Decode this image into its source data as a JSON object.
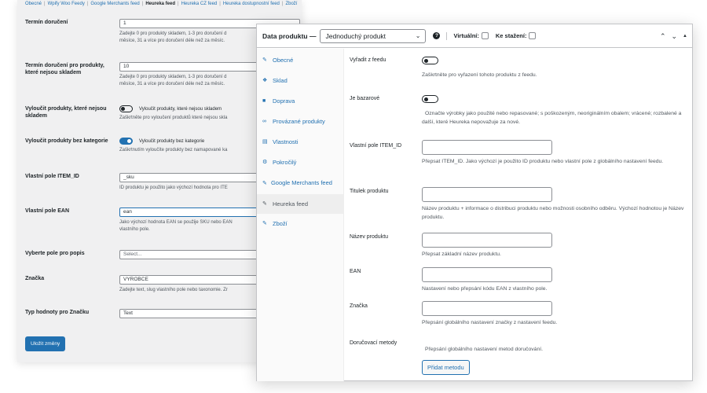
{
  "settings": {
    "subnav": [
      "Obecné",
      "Wpify Woo Feedy",
      "Google Merchants feed",
      "Heureka feed",
      "Heureka CZ feed",
      "Heureka dostupnostní feed",
      "Zboží"
    ],
    "subnav_current_index": 3,
    "delivery_label": "Termín doručení",
    "delivery_value": "1",
    "delivery_desc_1": "Zadejte 0 pro produkty skladem, 1-3 pro doručení d",
    "delivery_desc_2": "měsíce, 31 a více pro doručení déle než za měsíc.",
    "delivery_oos_label": "Termín doručení pro produkty, které nejsou skladem",
    "delivery_oos_value": "10",
    "delivery_oos_desc_1": "Zadejte 0 pro produkty skladem, 1-3 pro doručení d",
    "delivery_oos_desc_2": "měsíce, 31 a více pro doručení déle než za měsíc.",
    "exclude_oos_label": "Vyloučit produkty, které nejsou skladem",
    "exclude_oos_toggle": "Vyloučit produkty, které nejsou skladem",
    "exclude_oos_desc": "Zaškrtněte pro vyloučení produktů které nejsou skla",
    "exclude_nocat_label": "Vyloučit produkty bez kategorie",
    "exclude_nocat_toggle": "Vyloučit produkty bez kategorie",
    "exclude_nocat_desc": "Zaškrtnutím vyloučíte produkty bez namapované ka",
    "itemid_label": "Vlastní pole ITEM_ID",
    "itemid_value": "_sku",
    "itemid_desc": "ID produktu je použito jako výchozí hodnota pro ITE",
    "ean_label": "Vlastní pole EAN",
    "ean_value": "ean",
    "ean_desc_1": "Jako výchozí hodnota EAN se použije SKU nebo EAN",
    "ean_desc_2": "vlastního pole.",
    "desc_field_label": "Vyberte pole pro popis",
    "desc_field_placeholder": "Select...",
    "brand_label": "Značka",
    "brand_value": "VYROBCE",
    "brand_desc": "Zadejte text, slug vlastního pole nebo taxonomie. Zr",
    "brand_type_label": "Typ hodnoty pro Značku",
    "brand_type_value": "Text",
    "save_label": "Uložit změny"
  },
  "product": {
    "title": "Data produktu —",
    "type": "Jednoduchý produkt",
    "virtual_label": "Virtuální:",
    "download_label": "Ke stažení:",
    "tabs": [
      {
        "label": "Obecné",
        "icon": "wrench-icon"
      },
      {
        "label": "Sklad",
        "icon": "tag-icon"
      },
      {
        "label": "Doprava",
        "icon": "truck-icon"
      },
      {
        "label": "Provázané produkty",
        "icon": "link-icon"
      },
      {
        "label": "Vlastnosti",
        "icon": "list-icon"
      },
      {
        "label": "Pokročilý",
        "icon": "gear-icon"
      },
      {
        "label": "Google Merchants feed",
        "icon": "wrench-icon"
      },
      {
        "label": "Heureka feed",
        "icon": "wrench-icon"
      },
      {
        "label": "Zboží",
        "icon": "wrench-icon"
      }
    ],
    "active_tab_index": 7,
    "fields": {
      "exclude_label": "Vyřadit z feedu",
      "exclude_desc": "Zaškrtněte pro vyřazení tohoto produktu z feedu.",
      "bazaar_label": "Je bazarové",
      "bazaar_desc": "Označte výrobky jako použité nebo repasované; s poškozeným, neoriginálním obalem; vrácené; rozbalené a další, které Heureka nepovažuje za nové.",
      "itemid_label": "Vlastní pole ITEM_ID",
      "itemid_desc": "Přepsat ITEM_ID. Jako výchozí je použito ID produktu nebo vlastní pole z globálního nastavení feedu.",
      "title_label": "Titulek produktu",
      "title_desc": "Název produktu + informace o distribuci produktu nebo možnosti osobního odběru. Výchozí hodnotou je Název produktu.",
      "name_label": "Název produktu",
      "name_desc": "Přepsat základní název produktu.",
      "ean_label": "EAN",
      "ean_desc": "Nastavení nebo přepsání kódu EAN z vlastního pole.",
      "brand_label": "Značka",
      "brand_desc": "Přepsání globálního nastavení značky z nastavení feedu.",
      "delivery_label": "Doručovací metody",
      "delivery_desc": "Přepsání globálního nastavení metod doručování.",
      "add_method_label": "Přidat metodu"
    }
  }
}
